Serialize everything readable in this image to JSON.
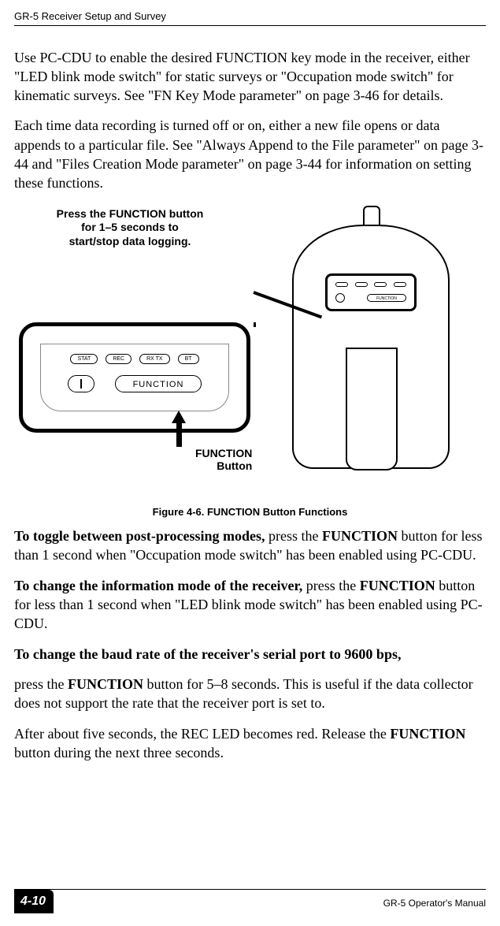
{
  "header": {
    "section": "GR-5 Receiver Setup and Survey"
  },
  "paragraphs": {
    "p1": "Use PC-CDU to enable the desired FUNCTION key mode in the receiver, either \"LED blink mode switch\" for static surveys or \"Occupation mode switch\" for kinematic surveys. See \"FN Key Mode parameter\" on page 3-46 for details.",
    "p2": "Each time data recording is turned off or on, either a new file opens or data appends to a particular file. See \"Always Append to the File parameter\" on page 3-44 and \"Files Creation Mode parameter\" on page 3-44 for information on setting these functions.",
    "p3_lead": "To toggle between post-processing modes,",
    "p3_rest_a": " press the ",
    "p3_fn": "FUNCTION",
    "p3_rest_b": " button for less than 1 second when \"Occupation mode switch\" has been enabled using PC-CDU.",
    "p4_lead": "To change the information mode of the receiver,",
    "p4_rest_a": " press the ",
    "p4_fn": "FUNCTION",
    "p4_rest_b": " button for less than 1 second when \"LED blink mode switch\" has been enabled using PC-CDU.",
    "p5_lead": "To change the baud rate of the receiver's serial port to 9600 bps,",
    "p5_rest_a": "press the ",
    "p5_fn": "FUNCTION",
    "p5_rest_b": " button for 5–8 seconds. This is useful if the data collector does not support the rate that the receiver port is set to.",
    "p6_a": "After about five seconds, the REC LED becomes red. Release the ",
    "p6_fn": "FUNCTION",
    "p6_b": " button during the next three seconds."
  },
  "figure": {
    "hint": "Press the FUNCTION button for 1–5 seconds to start/stop data logging.",
    "fn_label_line1": "FUNCTION",
    "fn_label_line2": "Button",
    "caption": "Figure 4-6. FUNCTION Button Functions",
    "leds": {
      "a": "STAT",
      "b": "REC",
      "c": "RX TX",
      "d": "BT"
    },
    "fn_button": "FUNCTION",
    "mini_fn": "FUNCTION"
  },
  "footer": {
    "page": "4-10",
    "manual": "GR-5 Operator's Manual"
  }
}
